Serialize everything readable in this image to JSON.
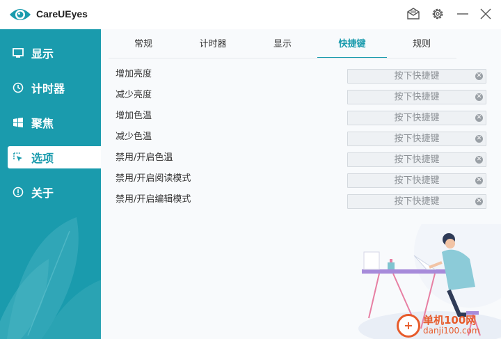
{
  "app": {
    "title": "CareUEyes"
  },
  "sidebar": {
    "items": [
      {
        "label": "显示",
        "icon": "monitor-icon",
        "active": false
      },
      {
        "label": "计时器",
        "icon": "clock-icon",
        "active": false
      },
      {
        "label": "聚焦",
        "icon": "windows-icon",
        "active": false
      },
      {
        "label": "选项",
        "icon": "cursor-select-icon",
        "active": true
      },
      {
        "label": "关于",
        "icon": "info-icon",
        "active": false
      }
    ]
  },
  "tabs": [
    {
      "label": "常规",
      "active": false
    },
    {
      "label": "计时器",
      "active": false
    },
    {
      "label": "显示",
      "active": false
    },
    {
      "label": "快捷键",
      "active": true
    },
    {
      "label": "规则",
      "active": false
    }
  ],
  "hotkeys": [
    {
      "label": "增加亮度",
      "placeholder": "按下快捷键"
    },
    {
      "label": "减少亮度",
      "placeholder": "按下快捷键"
    },
    {
      "label": "增加色温",
      "placeholder": "按下快捷键"
    },
    {
      "label": "减少色温",
      "placeholder": "按下快捷键"
    },
    {
      "label": "禁用/开启色温",
      "placeholder": "按下快捷键"
    },
    {
      "label": "禁用/开启阅读模式",
      "placeholder": "按下快捷键"
    },
    {
      "label": "禁用/开启编辑模式",
      "placeholder": "按下快捷键"
    }
  ],
  "watermark": {
    "line1": "单机100网",
    "line2": "danji100.com"
  },
  "colors": {
    "accent": "#1a9bad",
    "sidebar_bg": "#1a9bad",
    "main_bg": "#f8fafc",
    "watermark": "#e75b2b"
  }
}
